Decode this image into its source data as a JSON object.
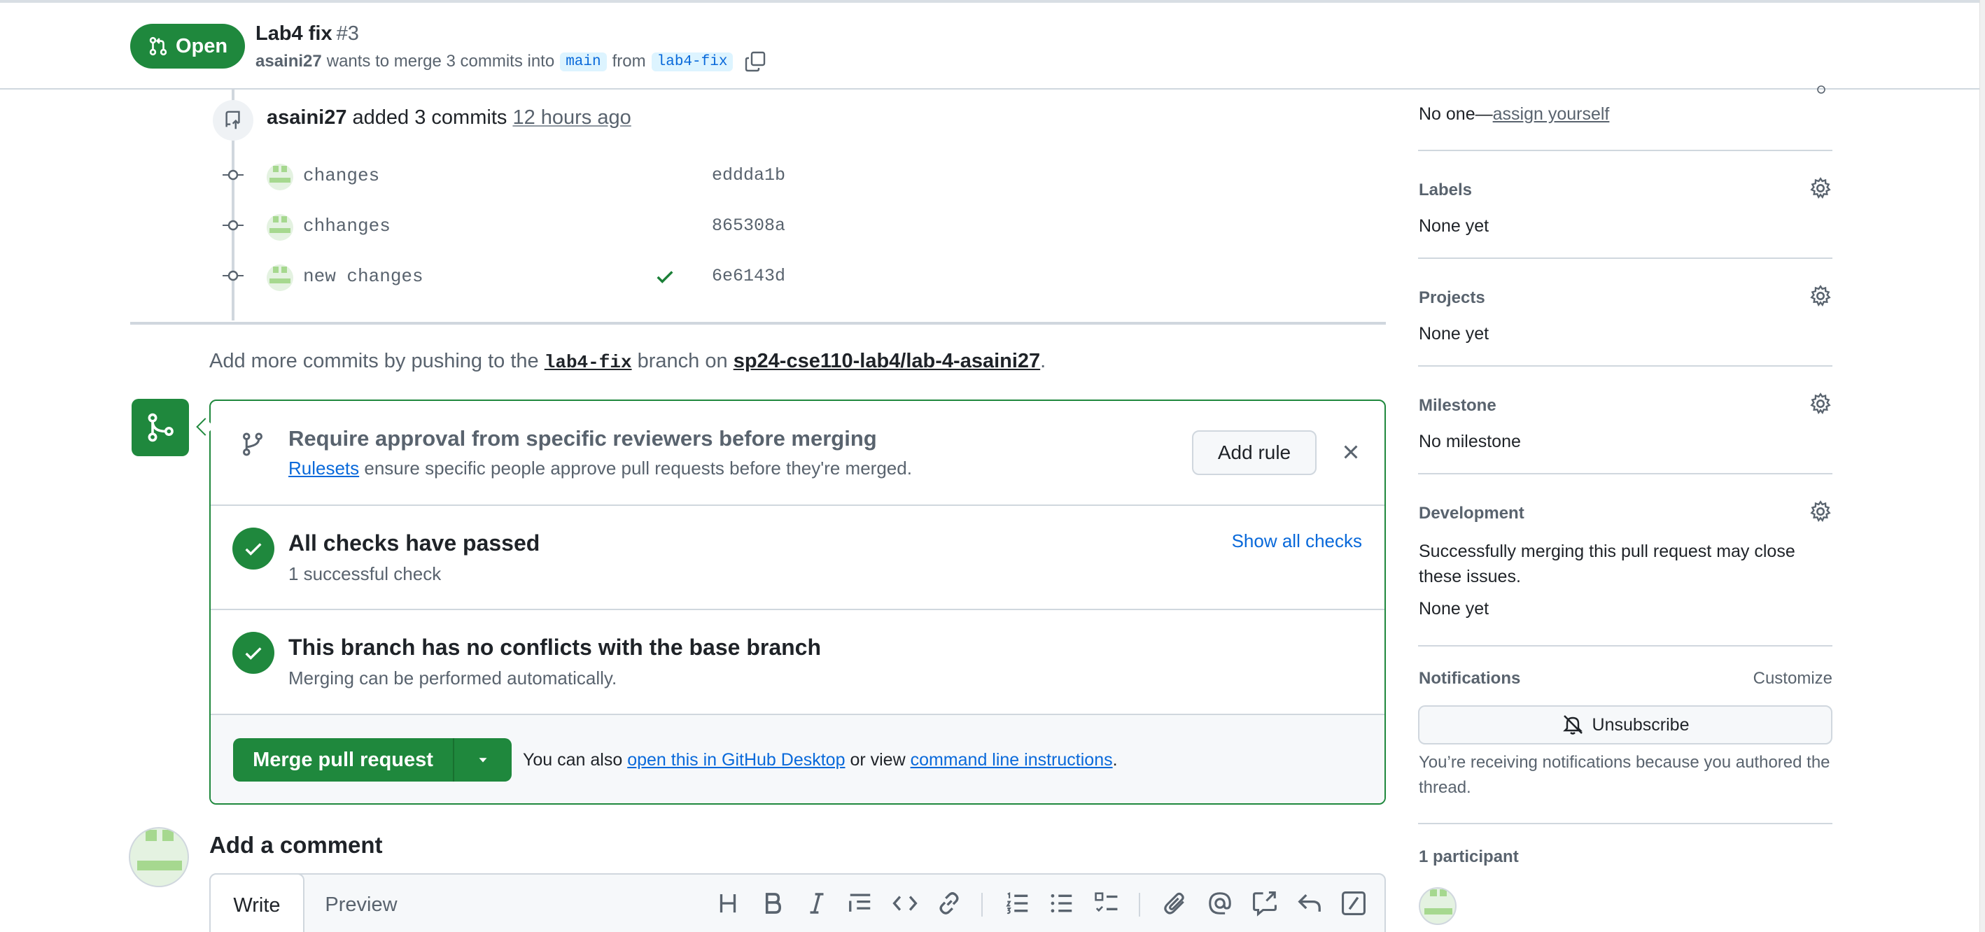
{
  "header": {
    "state": "Open",
    "title": "Lab4 fix",
    "number": "#3",
    "author": "asaini27",
    "merge_text": "wants to merge 3 commits into",
    "base_branch": "main",
    "from_text": "from",
    "head_branch": "lab4-fix"
  },
  "timeline": {
    "event_author": "asaini27",
    "event_text": "added 3 commits",
    "event_time": "12 hours ago",
    "commits": [
      {
        "message": "changes",
        "sha": "eddda1b"
      },
      {
        "message": "chhanges",
        "sha": "865308a"
      },
      {
        "message": "new changes",
        "sha": "6e6143d"
      }
    ],
    "push_hint": {
      "prefix": "Add more commits by pushing to the",
      "branch": "lab4-fix",
      "middle": "branch on",
      "repo": "sp24-cse110-lab4/lab-4-asaini27",
      "suffix": "."
    }
  },
  "merge_box": {
    "rules": {
      "title": "Require approval from specific reviewers before merging",
      "link": "Rulesets",
      "desc": "ensure specific people approve pull requests before they're merged.",
      "button": "Add rule"
    },
    "checks": {
      "title": "All checks have passed",
      "subtitle": "1 successful check",
      "link": "Show all checks"
    },
    "conflicts": {
      "title": "This branch has no conflicts with the base branch",
      "subtitle": "Merging can be performed automatically."
    },
    "merge": {
      "button": "Merge pull request",
      "hint_prefix": "You can also",
      "desktop_link": "open this in GitHub Desktop",
      "hint_middle": "or view",
      "cli_link": "command line instructions",
      "hint_suffix": "."
    }
  },
  "comment": {
    "title": "Add a comment",
    "tab_write": "Write",
    "tab_preview": "Preview",
    "toolbar": [
      "heading-icon",
      "bold-icon",
      "italic-icon",
      "quote-icon",
      "code-icon",
      "link-icon",
      "ordered-list-icon",
      "unordered-list-icon",
      "task-list-icon",
      "attach-icon",
      "mention-icon",
      "reference-icon",
      "reply-icon",
      "slash-command-icon"
    ]
  },
  "sidebar": {
    "assignees_none": "No one—",
    "assignees_link": "assign yourself",
    "labels": {
      "heading": "Labels",
      "value": "None yet"
    },
    "projects": {
      "heading": "Projects",
      "value": "None yet"
    },
    "milestone": {
      "heading": "Milestone",
      "value": "No milestone"
    },
    "development": {
      "heading": "Development",
      "desc": "Successfully merging this pull request may close these issues.",
      "value": "None yet"
    },
    "notifications": {
      "heading": "Notifications",
      "customize": "Customize",
      "button": "Unsubscribe",
      "reason": "You’re receiving notifications because you authored the thread."
    },
    "participants": {
      "heading": "1 participant"
    }
  },
  "colors": {
    "accent_green": "#1f883d",
    "link_blue": "#0969da",
    "muted": "#59636e",
    "border": "#d0d7de"
  }
}
